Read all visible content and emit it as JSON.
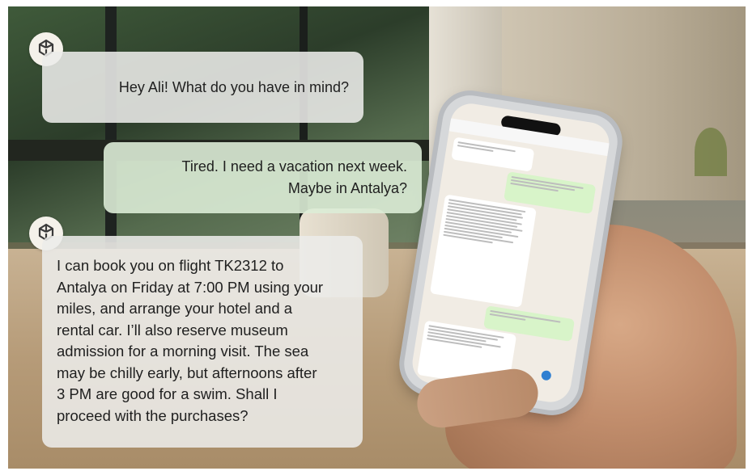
{
  "chat": {
    "assistant_greeting": "Hey Ali! What do you have in mind?",
    "user_message_lines": [
      "Tired. I need a vacation next week.",
      "Maybe in Antalya?"
    ],
    "assistant_reply_lines": [
      "I can book you on flight TK2312 to",
      "Antalya on Friday at 7:00 PM using your",
      "miles, and arrange your hotel and a",
      "rental car. I’ll also reserve museum",
      "admission for a morning visit. The sea",
      "may be chilly early, but afternoons after",
      "3 PM are good for a swim. Shall I",
      "proceed with the purchases?"
    ]
  },
  "icons": {
    "assistant_avatar": "openai-logo-icon"
  }
}
